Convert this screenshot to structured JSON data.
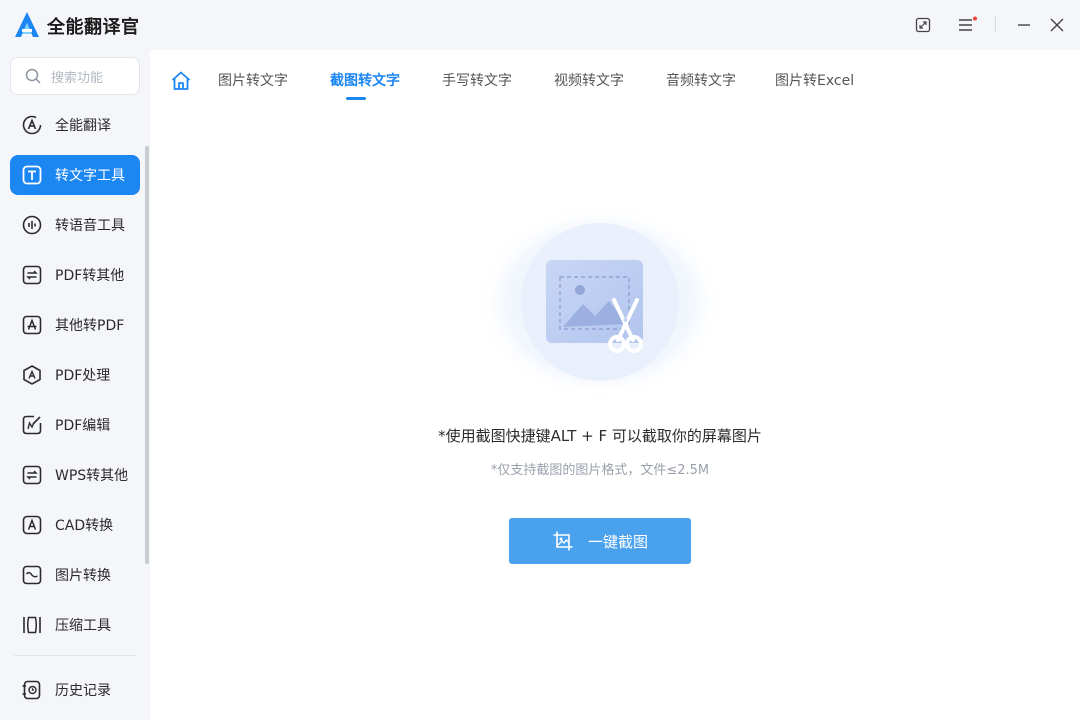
{
  "app": {
    "title": "全能翻译官"
  },
  "search": {
    "placeholder": "搜索功能"
  },
  "sidebar": {
    "items": [
      {
        "label": "全能翻译",
        "icon": "translate-icon"
      },
      {
        "label": "转文字工具",
        "icon": "text-tool-icon",
        "active": true
      },
      {
        "label": "转语音工具",
        "icon": "voice-icon"
      },
      {
        "label": "PDF转其他",
        "icon": "pdf-convert-icon"
      },
      {
        "label": "其他转PDF",
        "icon": "to-pdf-icon"
      },
      {
        "label": "PDF处理",
        "icon": "pdf-process-icon"
      },
      {
        "label": "PDF编辑",
        "icon": "pdf-edit-icon"
      },
      {
        "label": "WPS转其他",
        "icon": "wps-icon"
      },
      {
        "label": "CAD转换",
        "icon": "cad-icon"
      },
      {
        "label": "图片转换",
        "icon": "image-convert-icon"
      },
      {
        "label": "压缩工具",
        "icon": "compress-icon"
      }
    ],
    "history": {
      "label": "历史记录",
      "icon": "history-icon"
    }
  },
  "tabs": [
    {
      "label": "图片转文字"
    },
    {
      "label": "截图转文字",
      "active": true
    },
    {
      "label": "手写转文字"
    },
    {
      "label": "视频转文字"
    },
    {
      "label": "音频转文字"
    },
    {
      "label": "图片转Excel"
    }
  ],
  "main": {
    "hint": "*使用截图快捷键ALT + F 可以截取你的屏幕图片",
    "sub_hint": "*仅支持截图的图片格式，文件≤2.5M",
    "button_label": "一键截图"
  },
  "colors": {
    "accent": "#1c86f2",
    "button": "#4aa2ee",
    "notification": "#e8453c"
  }
}
